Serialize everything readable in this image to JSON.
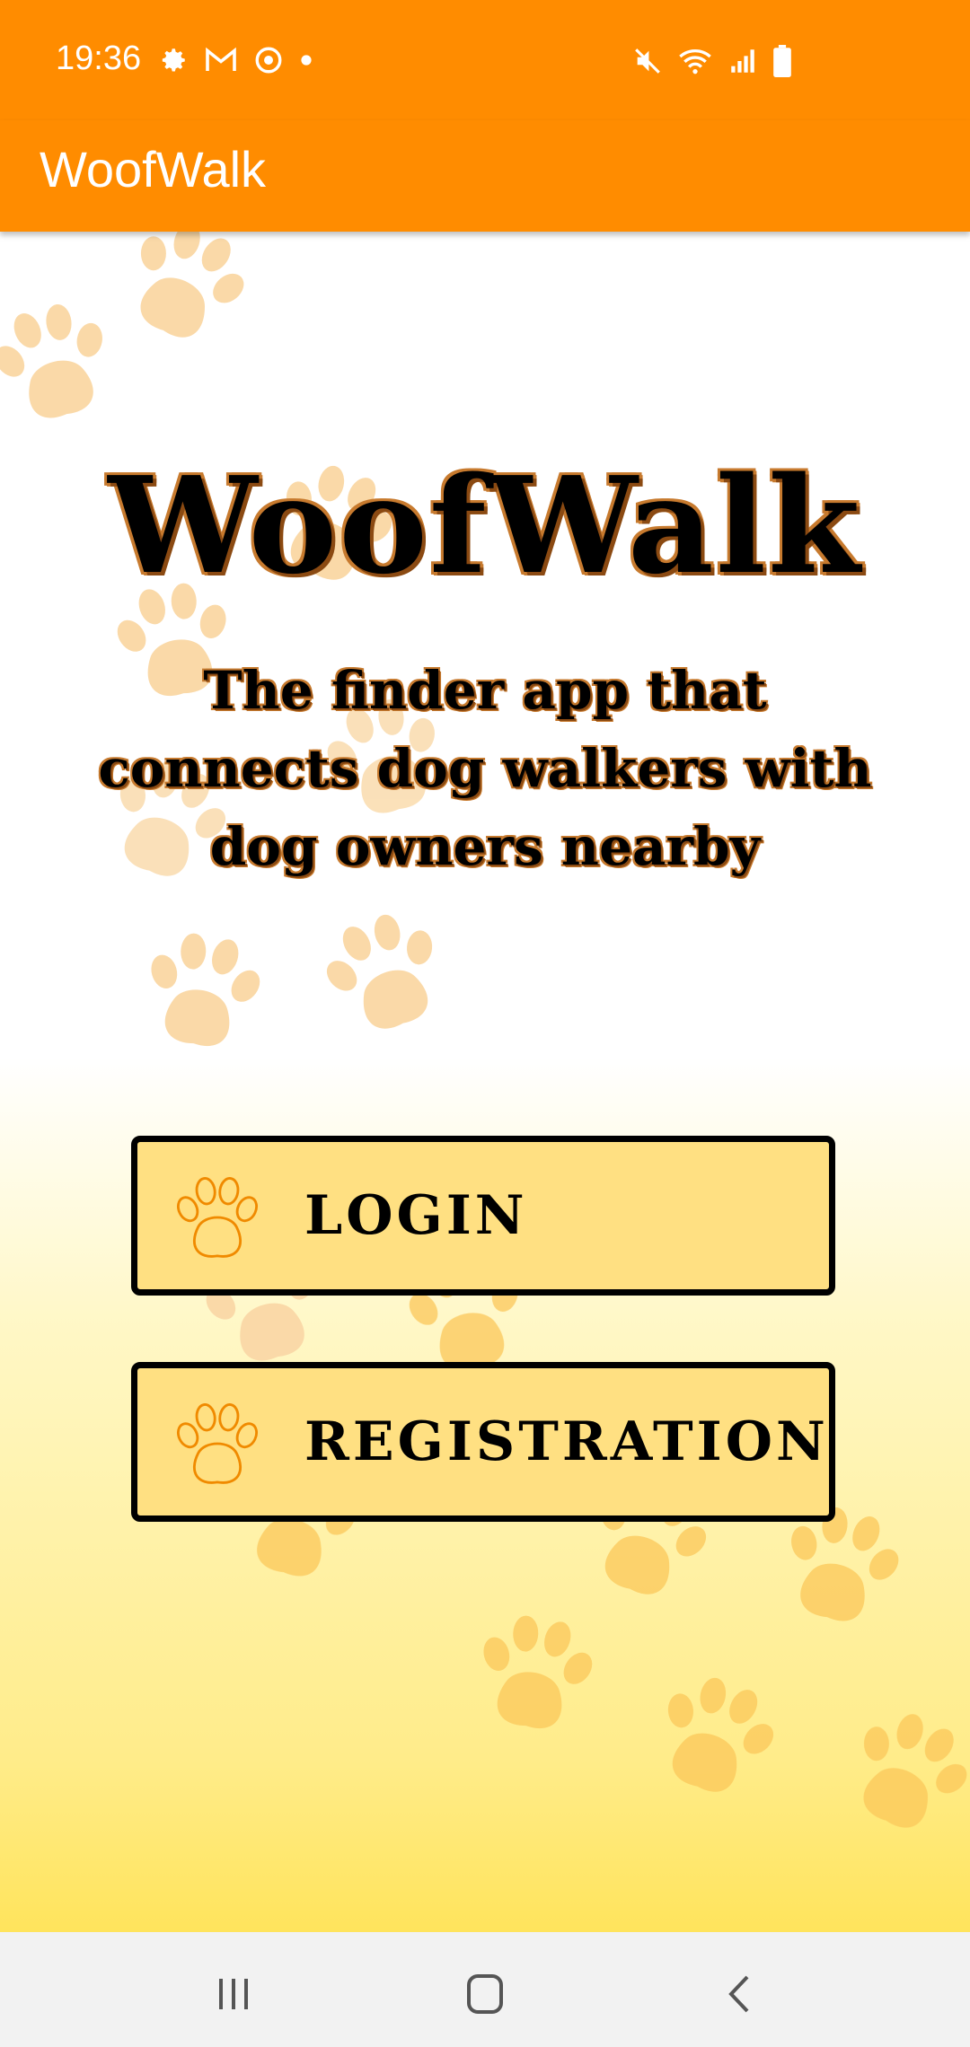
{
  "status_bar": {
    "time": "19:36",
    "left_icons": [
      "gear-icon",
      "gmail-icon",
      "sync-icon",
      "dot-icon"
    ],
    "right_icons": [
      "mute-icon",
      "wifi-icon",
      "signal-icon",
      "battery-icon"
    ]
  },
  "app_bar": {
    "title": "WoofWalk"
  },
  "hero": {
    "title": "WoofWalk",
    "subtitle": "The finder app that connects dog walkers with dog owners nearby"
  },
  "buttons": {
    "login": {
      "label": "LOGIN",
      "icon": "paw-icon"
    },
    "registration": {
      "label": "REGISTRATION",
      "icon": "paw-icon"
    }
  },
  "nav_bar": {
    "items": [
      "recent-apps-icon",
      "home-icon",
      "back-icon"
    ]
  },
  "colors": {
    "primary": "#FF8C00",
    "button_fill": "#FFE082",
    "paw_light": "#FAD9A8",
    "paw_yellow": "#FBC75A"
  }
}
